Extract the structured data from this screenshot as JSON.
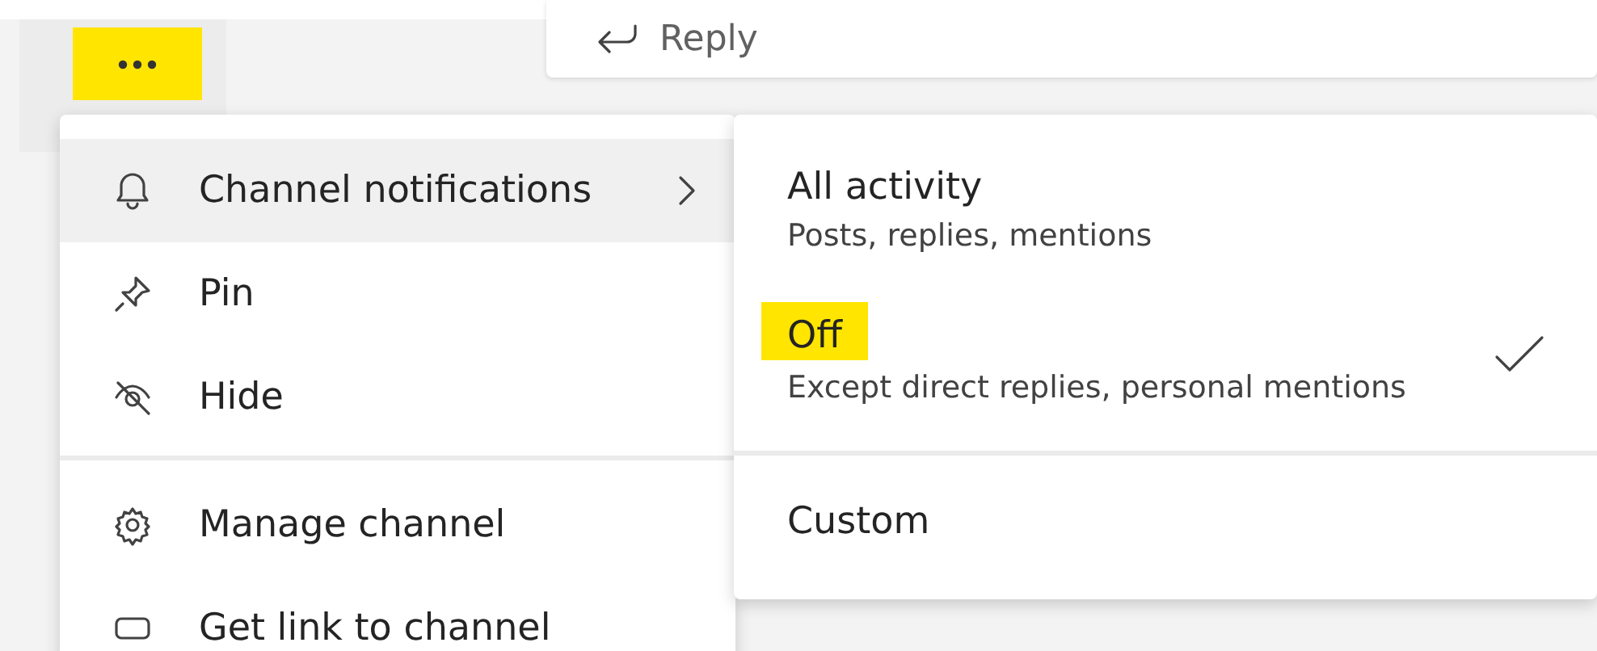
{
  "more_button": {
    "highlighted": true
  },
  "reply_button": {
    "label": "Reply"
  },
  "menu": {
    "sections": [
      {
        "items": [
          {
            "label": "Channel notifications",
            "has_submenu": true,
            "selected": true
          },
          {
            "label": "Pin",
            "has_submenu": false,
            "selected": false
          },
          {
            "label": "Hide",
            "has_submenu": false,
            "selected": false
          }
        ]
      },
      {
        "items": [
          {
            "label": "Manage channel",
            "has_submenu": false,
            "selected": false
          },
          {
            "label": "Get link to channel",
            "has_submenu": false,
            "selected": false
          }
        ]
      }
    ]
  },
  "submenu": {
    "sections": [
      {
        "items": [
          {
            "title": "All activity",
            "subtitle": "Posts, replies, mentions",
            "checked": false,
            "highlighted": false
          },
          {
            "title": "Off",
            "subtitle": "Except direct replies, personal mentions",
            "checked": true,
            "highlighted": true
          }
        ]
      },
      {
        "items": [
          {
            "title": "Custom",
            "checked": false,
            "highlighted": false
          }
        ]
      }
    ]
  }
}
